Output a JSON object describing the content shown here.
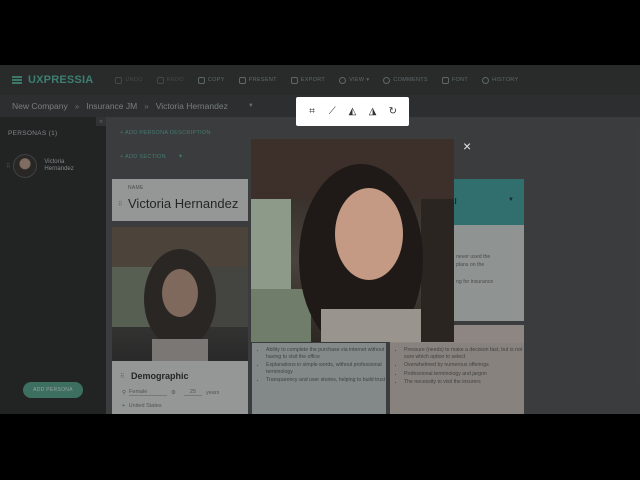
{
  "app": {
    "logo": "UXPRESSIA"
  },
  "toolbar": {
    "items": [
      {
        "label": "UNDO",
        "icon": "undo-icon",
        "enabled": false
      },
      {
        "label": "REDO",
        "icon": "redo-icon",
        "enabled": false
      },
      {
        "label": "COPY",
        "icon": "copy-icon",
        "enabled": true
      },
      {
        "label": "PRESENT",
        "icon": "present-icon",
        "enabled": true
      },
      {
        "label": "EXPORT",
        "icon": "export-icon",
        "enabled": true
      },
      {
        "label": "VIEW",
        "icon": "eye-icon",
        "enabled": true
      },
      {
        "label": "COMMENTS",
        "icon": "comment-icon",
        "enabled": true
      },
      {
        "label": "FONT",
        "icon": "font-icon",
        "enabled": true
      },
      {
        "label": "HISTORY",
        "icon": "history-icon",
        "enabled": true
      }
    ]
  },
  "breadcrumb": {
    "company": "New Company",
    "project": "Insurance JM",
    "persona": "Victoria Hernandez"
  },
  "sidebar": {
    "title": "PERSONAS (1)",
    "persona_name": "Victoria Hernandez",
    "add_button": "ADD PERSONA"
  },
  "main": {
    "add_description": "+ ADD PERSONA DESCRIPTION",
    "add_section": "+ ADD SECTION",
    "name_label": "NAME",
    "name_value": "Victoria Hernandez",
    "demographic_title": "Demographic",
    "gender": "Female",
    "age": "25",
    "age_unit": "years",
    "location": "United States",
    "mid_list": [
      "Ability to complete the purchase via internet without having to visit the office",
      "Explanations in simple words, without professional terminology",
      "Transparency and user stories, helping to build trust"
    ],
    "right_list": [
      "Pressure (needs) to make a decision fast, but is not sure which option to select",
      "Overwhelmed by numerous offerings",
      "Professional terminology and jargon",
      "The necessity to visit the insurers"
    ],
    "right_card_fragments": [
      "al",
      "never used the",
      "plans on the",
      "ng for insurance"
    ]
  },
  "modal": {
    "close_label": "×"
  }
}
